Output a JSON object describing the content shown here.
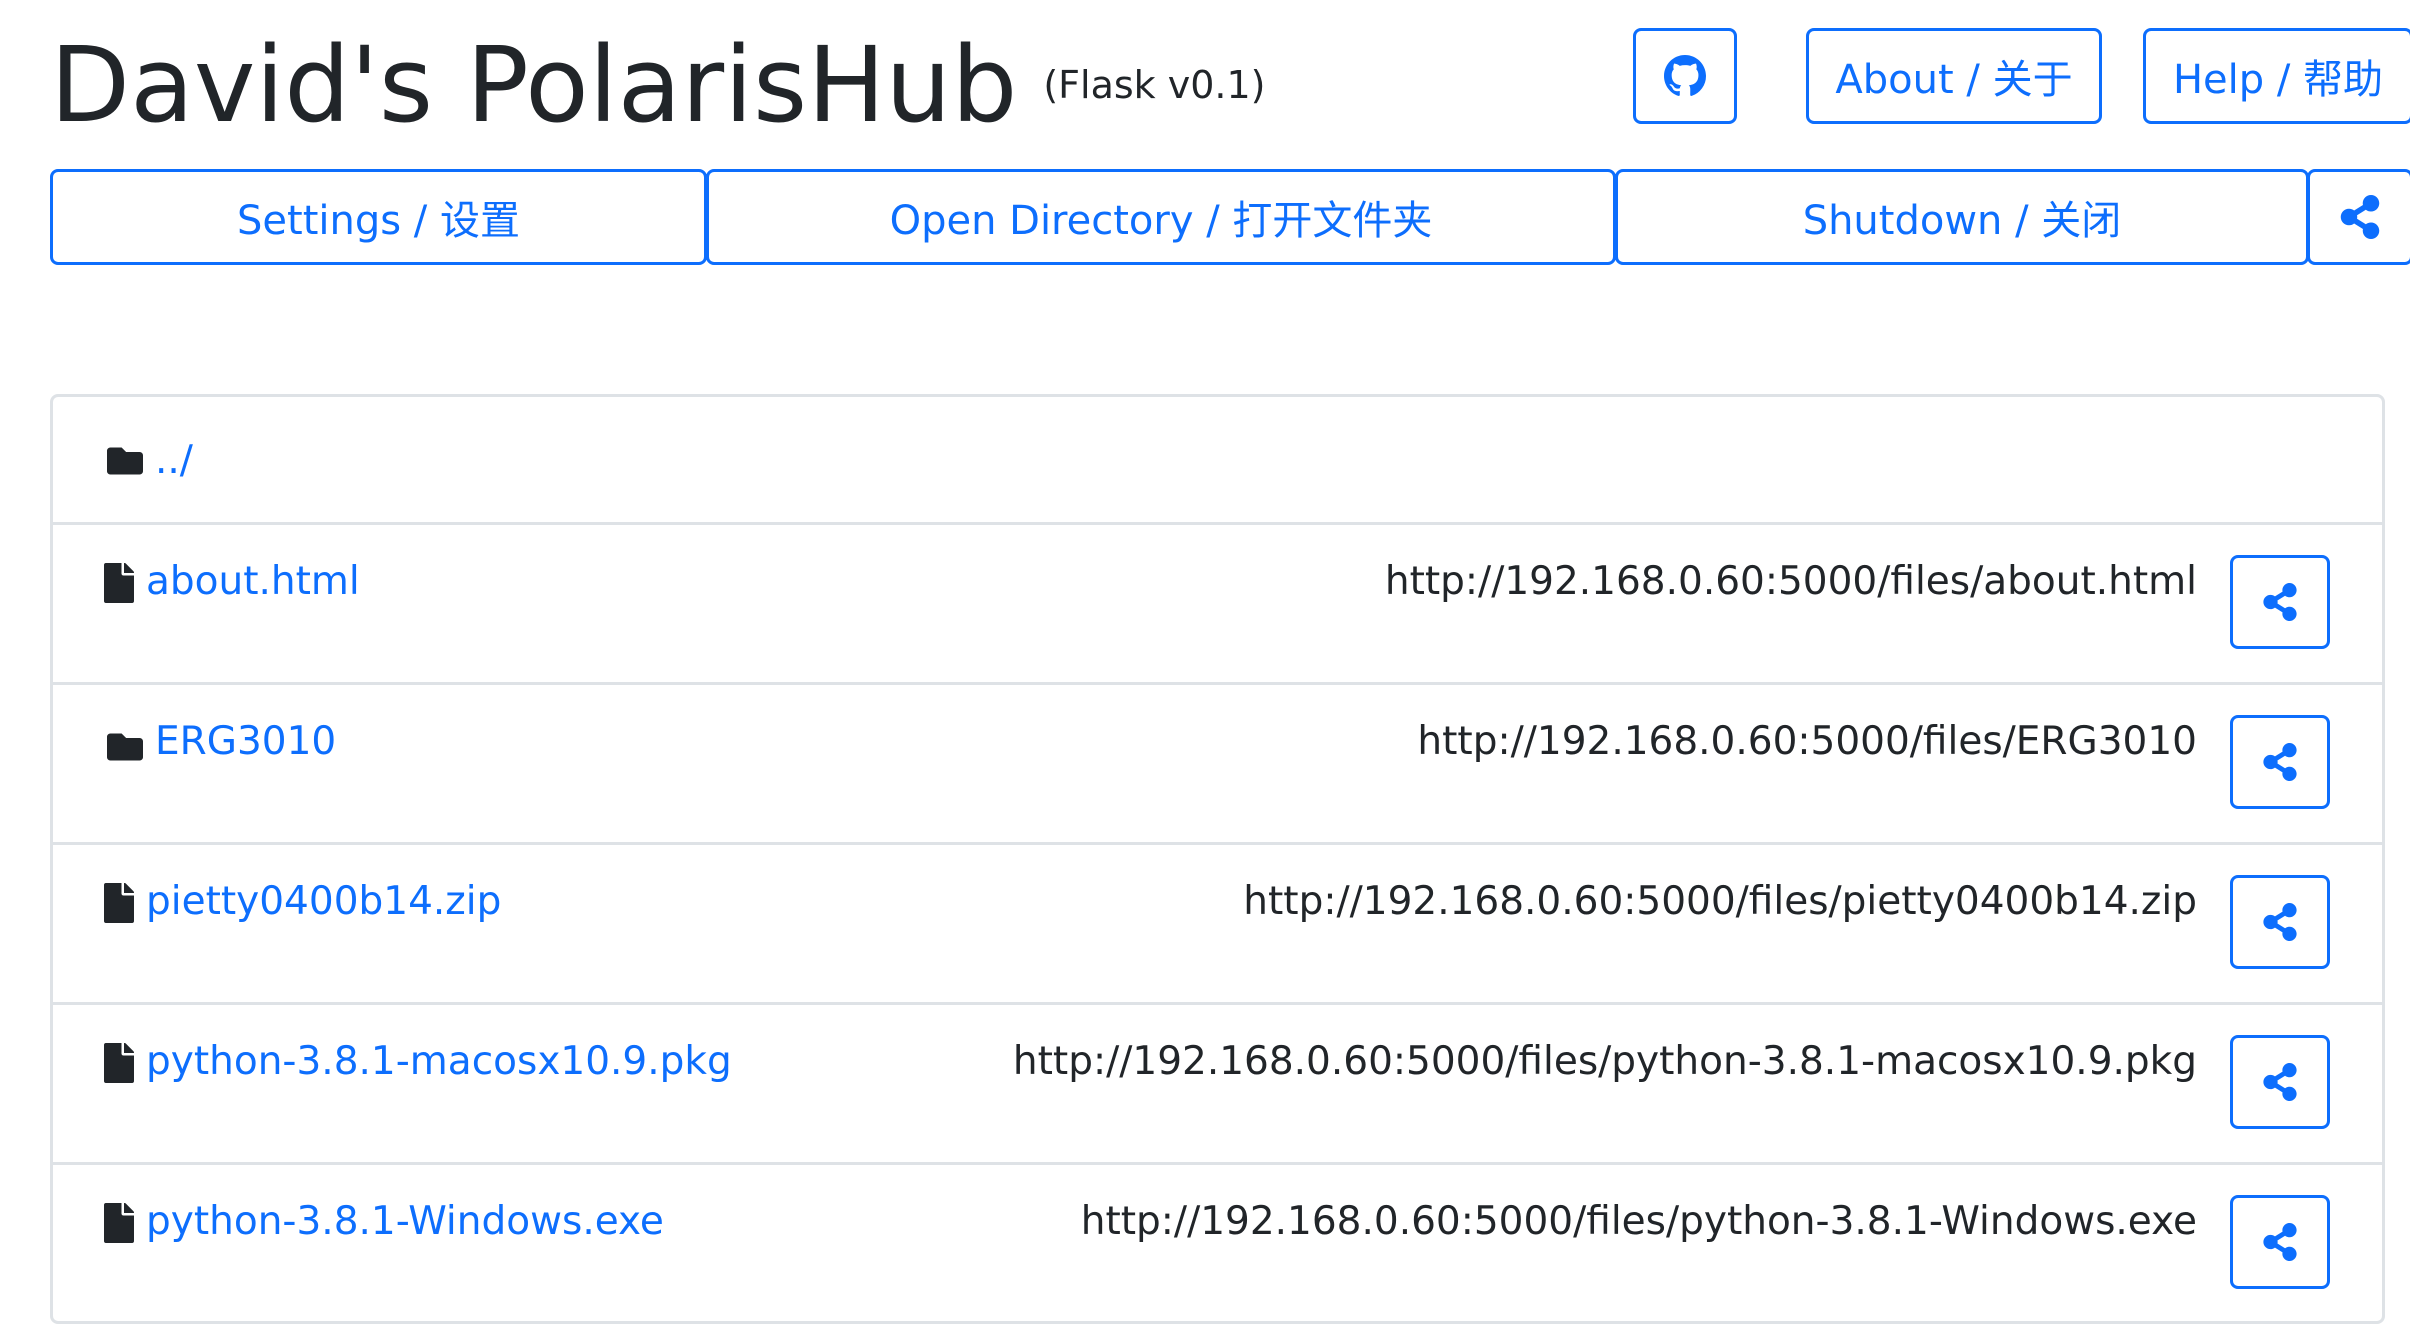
{
  "header": {
    "title": "David's PolarisHub",
    "subtitle": "(Flask v0.1)"
  },
  "top_buttons": {
    "github_icon": "github-icon",
    "about_label": "About / 关于",
    "help_label": "Help / 帮助"
  },
  "toolbar": {
    "settings_label": "Settings / 设置",
    "open_directory_label": "Open Directory / 打开文件夹",
    "shutdown_label": "Shutdown / 关闭",
    "share_icon": "share-icon"
  },
  "files": {
    "parent": {
      "name": "../",
      "icon": "folder-icon"
    },
    "items": [
      {
        "name": "about.html",
        "icon": "file-icon",
        "url": "http://192.168.0.60:5000/files/about.html"
      },
      {
        "name": "ERG3010",
        "icon": "folder-icon",
        "url": "http://192.168.0.60:5000/files/ERG3010"
      },
      {
        "name": "pietty0400b14.zip",
        "icon": "file-icon",
        "url": "http://192.168.0.60:5000/files/pietty0400b14.zip"
      },
      {
        "name": "python-3.8.1-macosx10.9.pkg",
        "icon": "file-icon",
        "url": "http://192.168.0.60:5000/files/python-3.8.1-macosx10.9.pkg"
      },
      {
        "name": "python-3.8.1-Windows.exe",
        "icon": "file-icon",
        "url": "http://192.168.0.60:5000/files/python-3.8.1-Windows.exe"
      }
    ]
  },
  "colors": {
    "primary": "#0d6efd",
    "text": "#212529",
    "border": "#dee2e6"
  }
}
